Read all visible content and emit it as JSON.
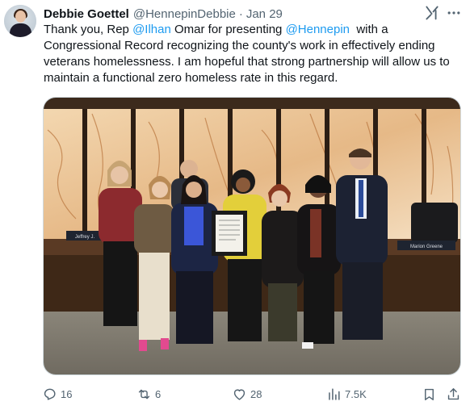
{
  "tweet": {
    "author_name": "Debbie Goettel",
    "author_handle": "@HennepinDebbie",
    "separator": "·",
    "date": "Jan 29",
    "text_parts": [
      {
        "text": "Thank you, Rep ",
        "type": "plain"
      },
      {
        "text": "@Ilhan",
        "type": "mention"
      },
      {
        "text": " Omar for presenting ",
        "type": "plain"
      },
      {
        "text": "@Hennepin",
        "type": "mention"
      },
      {
        "text": "  with a Congressional Record recognizing the county's work in effectively ending veterans homelessness. I am hopeful that strong partnership will allow us to maintain a functional zero homeless rate in this regard.",
        "type": "plain"
      }
    ],
    "photo": {
      "nameplate_left": "Jeffrey J.",
      "nameplate_right": "Marion Greene"
    },
    "actions": {
      "replies": "16",
      "reposts": "6",
      "likes": "28",
      "views": "7.5K"
    }
  },
  "icons": {
    "grok": "grok-icon",
    "more": "more-dots-icon",
    "reply": "reply-icon",
    "repost": "repost-icon",
    "like": "heart-icon",
    "views": "views-bar-icon",
    "bookmark": "bookmark-icon",
    "share": "share-icon"
  },
  "colors": {
    "text_primary": "#0f1419",
    "text_secondary": "#536471",
    "mention": "#1d9bf0"
  }
}
